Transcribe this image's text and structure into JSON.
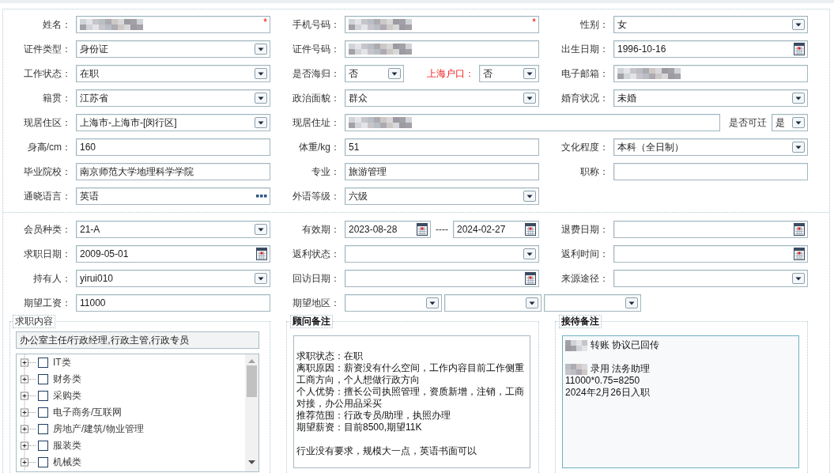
{
  "top_section": {
    "rows": [
      {
        "cells": [
          {
            "label": "姓名：",
            "kind": "text",
            "redacted": true,
            "required_mark": "*"
          },
          {
            "label": "手机号码：",
            "kind": "text",
            "redacted": true,
            "required_mark": "*"
          },
          {
            "label": "性别：",
            "kind": "select",
            "value": "女"
          }
        ]
      },
      {
        "cells": [
          {
            "label": "证件类型：",
            "kind": "select",
            "value": "身份证"
          },
          {
            "label": "证件号码：",
            "kind": "text",
            "redacted": true
          },
          {
            "label": "出生日期：",
            "kind": "date",
            "value": "1996-10-16"
          }
        ]
      },
      {
        "cells": [
          {
            "label": "工作状态：",
            "kind": "select",
            "value": "在职"
          },
          {
            "label": "是否海归：",
            "kind": "select",
            "value": "否",
            "addon": {
              "label": "上海户口：",
              "highlighted": true,
              "kind": "select",
              "value": "否"
            }
          },
          {
            "label": "电子邮箱：",
            "kind": "text",
            "redacted": true
          }
        ]
      },
      {
        "cells": [
          {
            "label": "籍贯：",
            "kind": "select",
            "value": "江苏省"
          },
          {
            "label": "政治面貌：",
            "kind": "select",
            "value": "群众"
          },
          {
            "label": "婚育状况：",
            "kind": "select",
            "value": "未婚"
          }
        ]
      },
      {
        "cells": [
          {
            "label": "现居住区：",
            "kind": "select",
            "value": "上海市-上海市-[闵行区]"
          },
          {
            "label": "现居住址：",
            "kind": "text",
            "redacted": true,
            "addon": {
              "label": "是否可迁",
              "highlighted": false,
              "kind": "select",
              "value": "是"
            }
          }
        ]
      },
      {
        "cells": [
          {
            "label": "身高/cm：",
            "kind": "text",
            "value": "160"
          },
          {
            "label": "体重/kg：",
            "kind": "text",
            "value": "51"
          },
          {
            "label": "文化程度：",
            "kind": "select",
            "value": "本科（全日制）"
          }
        ]
      },
      {
        "cells": [
          {
            "label": "毕业院校：",
            "kind": "text",
            "value": "南京师范大学地理科学学院"
          },
          {
            "label": "专业：",
            "kind": "text",
            "value": "旅游管理"
          },
          {
            "label": "职称：",
            "kind": "text"
          }
        ]
      },
      {
        "cells": [
          {
            "label": "通晓语言：",
            "kind": "lookup",
            "value": "英语"
          },
          {
            "label": "外语等级：",
            "kind": "select",
            "value": "六级"
          }
        ]
      }
    ]
  },
  "bottom_section": {
    "rows": [
      {
        "cells": [
          {
            "label": "会员种类：",
            "kind": "select",
            "value": "21-A"
          },
          {
            "label": "有效期：",
            "kind": "date_range",
            "dates": [
              {
                "value": "2023-08-28"
              },
              {
                "value": "2024-02-27"
              }
            ],
            "separator": "----"
          },
          {
            "label": "退费日期：",
            "kind": "date"
          }
        ]
      },
      {
        "cells": [
          {
            "label": "求职日期：",
            "kind": "date",
            "value": "2009-05-01"
          },
          {
            "label": "返利状态：",
            "kind": "select"
          },
          {
            "label": "返利时间：",
            "kind": "date"
          }
        ]
      },
      {
        "cells": [
          {
            "label": "持有人：",
            "kind": "select",
            "value": "yirui010"
          },
          {
            "label": "回访日期：",
            "kind": "date"
          },
          {
            "label": "来源途径：",
            "kind": "select"
          }
        ]
      },
      {
        "cells": [
          {
            "label": "期望工资：",
            "kind": "text",
            "value": "11000"
          },
          {
            "label": "期望地区：",
            "kind": "select_group",
            "selects": [
              {
                "kind": "select"
              },
              {
                "kind": "select"
              },
              {
                "kind": "select"
              }
            ]
          }
        ]
      }
    ]
  },
  "job_intent": {
    "legend": "求职内容",
    "selected_text": "办公室主任/行政经理,行政主管,行政专员",
    "categories": [
      {
        "label": "IT类",
        "expanded": false,
        "checked": false
      },
      {
        "label": "财务类",
        "expanded": false,
        "checked": false
      },
      {
        "label": "采购类",
        "expanded": false,
        "checked": false
      },
      {
        "label": "电子商务/互联网",
        "expanded": false,
        "checked": false
      },
      {
        "label": "房地产/建筑/物业管理",
        "expanded": false,
        "checked": false
      },
      {
        "label": "服装类",
        "expanded": false,
        "checked": false
      },
      {
        "label": "机械类",
        "expanded": false,
        "checked": false
      }
    ]
  },
  "consultant_notes": {
    "legend": "顾问备注",
    "focused": false,
    "lines": [
      {
        "kind": "text",
        "text": "求职状态：在职"
      },
      {
        "kind": "text",
        "text": "离职原因：薪资没有什么空间，工作内容目前工作侧重工商方向，个人想做行政方向"
      },
      {
        "kind": "text",
        "text": "个人优势：擅长公司执照管理，资质新增，注销，工商对接，办公用品采买"
      },
      {
        "kind": "text",
        "text": "推荐范围：行政专员/助理，执照办理"
      },
      {
        "kind": "text",
        "text": "期望薪资：目前8500,期望11K"
      },
      {
        "kind": "blank"
      },
      {
        "kind": "text",
        "text": "行业没有要求，规模大一点，英语书面可以"
      }
    ]
  },
  "reception_notes": {
    "legend": "接待备注",
    "focused": true,
    "lines": [
      {
        "kind": "text",
        "redacted_prefix": true,
        "text": "转账 协议已回传"
      },
      {
        "kind": "blank"
      },
      {
        "kind": "text",
        "redacted_prefix": true,
        "text": "录用 法务助理"
      },
      {
        "kind": "text",
        "text": "11000*0.75=8250"
      },
      {
        "kind": "text",
        "text": "2024年2月26日入职"
      }
    ]
  }
}
